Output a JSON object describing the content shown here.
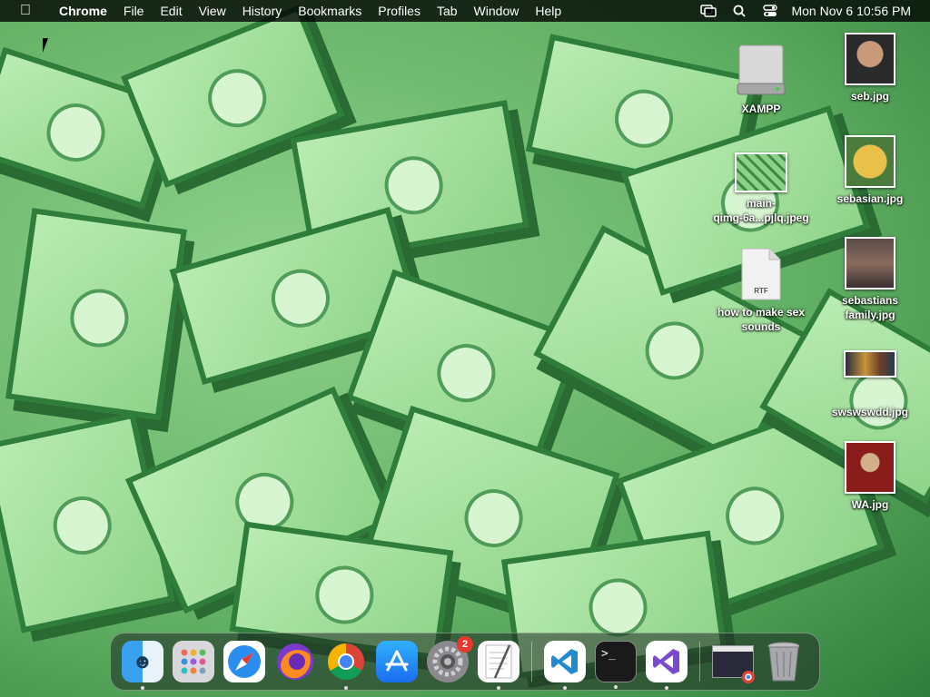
{
  "menubar": {
    "app_name": "Chrome",
    "menus": [
      "File",
      "Edit",
      "View",
      "History",
      "Bookmarks",
      "Profiles",
      "Tab",
      "Window",
      "Help"
    ],
    "clock": "Mon Nov 6  10:56 PM"
  },
  "desktop": {
    "icons_left": [
      {
        "label": "XAMPP"
      },
      {
        "label": "main-\nqimg-6a...pjlq.jpeg"
      },
      {
        "label": "how to make sex\nsounds",
        "badge": "RTF"
      }
    ],
    "icons_right": [
      {
        "label": "seb.jpg"
      },
      {
        "label": "sebasian.jpg"
      },
      {
        "label": "sebastians\nfamily.jpg"
      },
      {
        "label": "swswswdd.jpg"
      },
      {
        "label": "WA.jpg"
      }
    ]
  },
  "dock": {
    "apps": [
      {
        "name": "Finder",
        "running": true
      },
      {
        "name": "Launchpad",
        "running": false
      },
      {
        "name": "Safari",
        "running": false
      },
      {
        "name": "Firefox",
        "running": false
      },
      {
        "name": "Chrome",
        "running": true
      },
      {
        "name": "App Store",
        "running": false
      },
      {
        "name": "System Settings",
        "running": false,
        "badge": "2"
      },
      {
        "name": "TextEdit",
        "running": true
      },
      {
        "name": "Visual Studio Code",
        "running": true
      },
      {
        "name": "Terminal",
        "running": true
      },
      {
        "name": "Visual Studio",
        "running": true
      }
    ]
  },
  "colors": {
    "wallpaper_green": "#5fae62",
    "dock_bg": "#1e2823",
    "badge_red": "#e8382e"
  }
}
